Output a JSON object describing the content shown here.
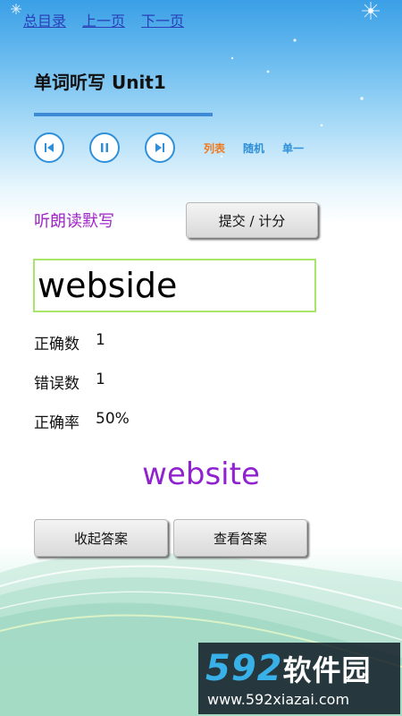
{
  "nav": {
    "home": "总目录",
    "prev": "上一页",
    "next": "下一页"
  },
  "title": "单词听写 Unit1",
  "player": {
    "controls": [
      "previous",
      "pause",
      "next"
    ],
    "modes": {
      "list": "列表",
      "random": "随机",
      "single": "单一"
    },
    "colors": {
      "list": "#f07a1e",
      "random": "#2f8fd8",
      "single": "#2f8fd8"
    }
  },
  "section": {
    "label": "听朗读默写",
    "submit": "提交 / 计分"
  },
  "input": {
    "value": "webside"
  },
  "stats": [
    {
      "label": "正确数",
      "value": "1"
    },
    {
      "label": "错误数",
      "value": "1"
    },
    {
      "label": "正确率",
      "value": "50%"
    }
  ],
  "answer": {
    "word": "website"
  },
  "buttons": {
    "hide": "收起答案",
    "show": "查看答案"
  },
  "watermark": {
    "logo_num": "592",
    "logo_cn": "软件园",
    "url": "www.592xiazai.com"
  }
}
